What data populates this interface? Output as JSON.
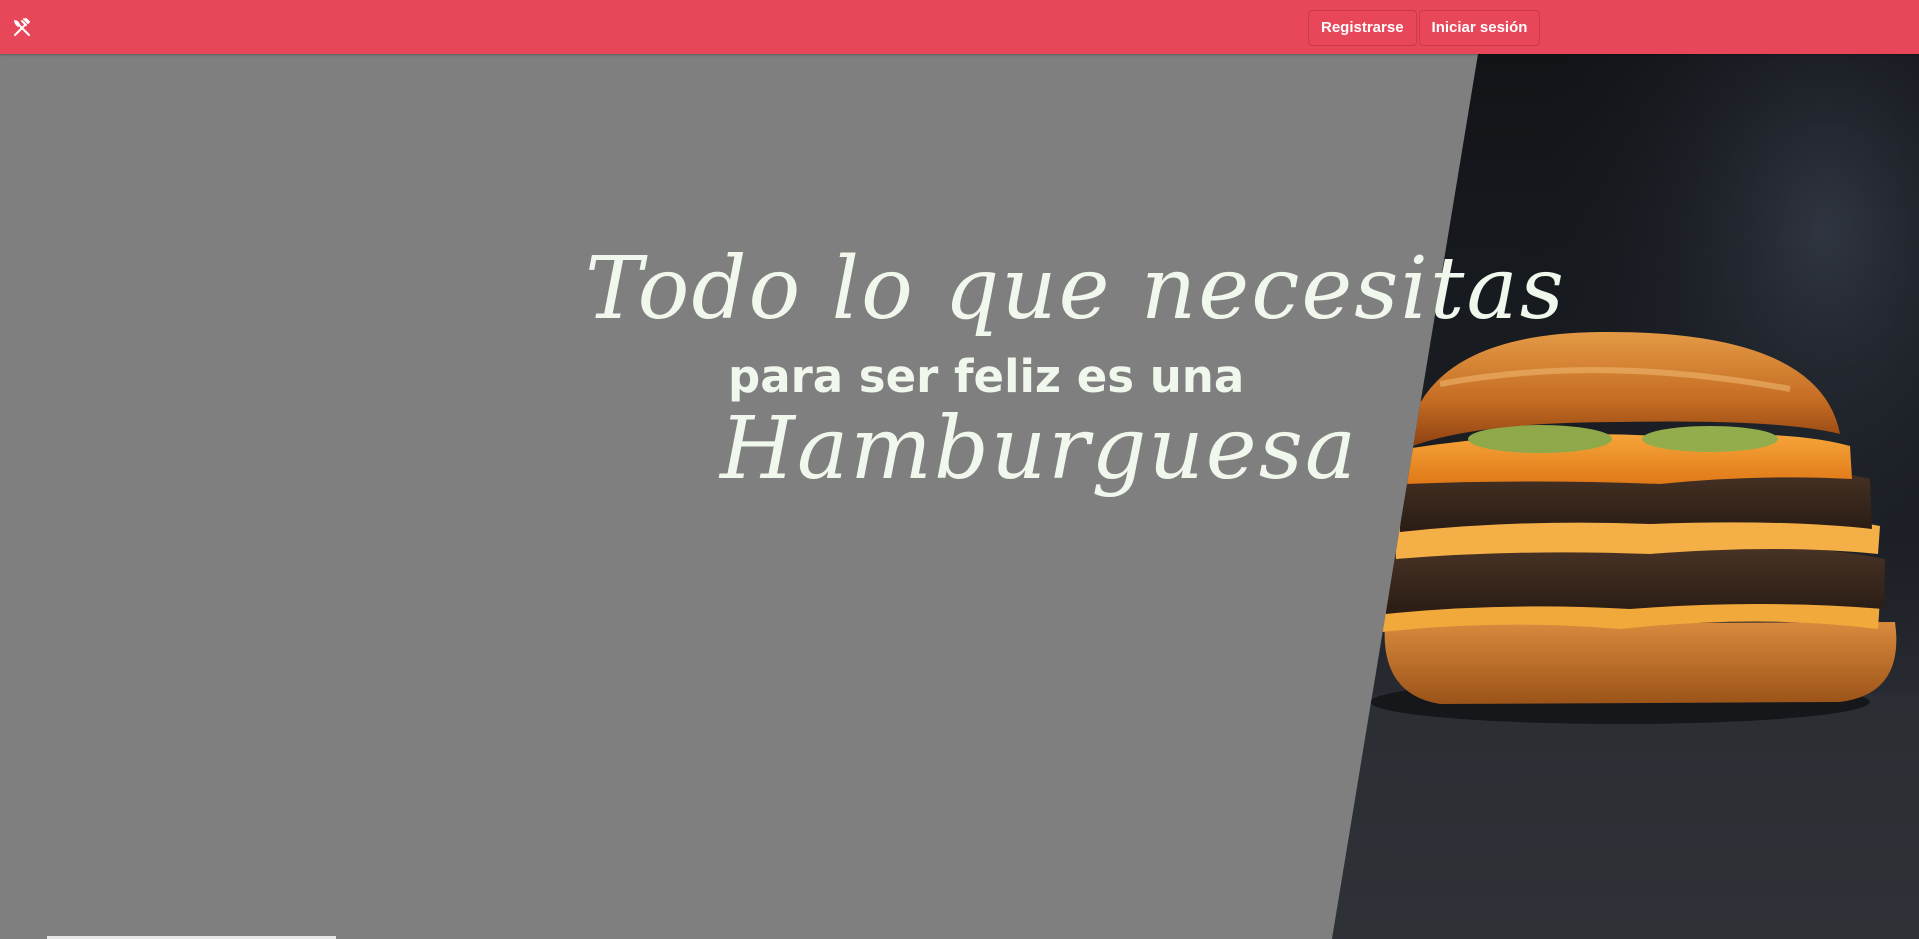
{
  "navbar": {
    "logo_icon": "utensils-cross-icon",
    "register_label": "Registrarse",
    "login_label": "Iniciar sesión",
    "background_color": "#e8475a"
  },
  "hero": {
    "line1": "Todo lo que necesitas",
    "line2": "para ser feliz es una",
    "line3": "Hamburguesa",
    "text_color": "#f0f7ec",
    "overlay_color": "#7f7f7f",
    "photo": "cheeseburger-photo"
  }
}
